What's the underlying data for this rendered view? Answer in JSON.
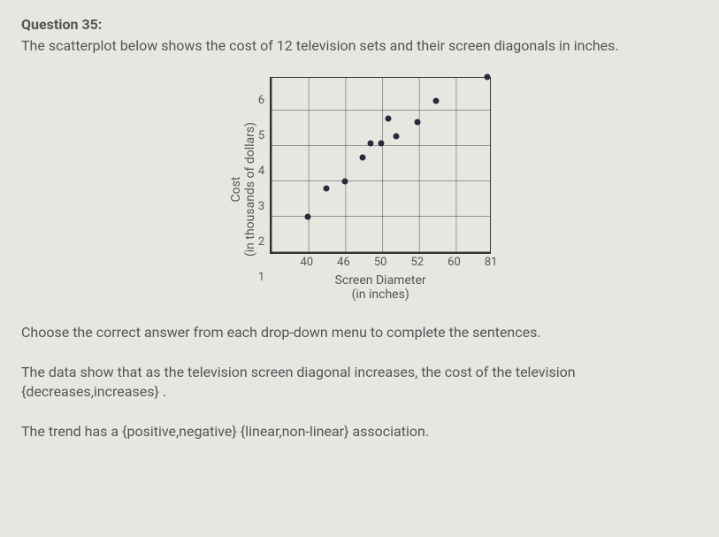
{
  "header": {
    "question_label": "Question 35:",
    "question_text": "The scatterplot below shows the cost of 12 television sets and their screen diagonals in inches."
  },
  "chart_data": {
    "type": "scatter",
    "title": "",
    "xlabel_line1": "Screen Diameter",
    "xlabel_line2": "(in inches)",
    "ylabel_line1": "Cost",
    "ylabel_line2": "(in thousands of dollars)",
    "x_ticks": [
      40,
      46,
      50,
      52,
      60,
      81
    ],
    "y_ticks": [
      1,
      2,
      3,
      4,
      5,
      6
    ],
    "x_cols": 6,
    "y_rows": 5,
    "points": [
      {
        "xi": 1.0,
        "yi": 1.0
      },
      {
        "xi": 1.5,
        "yi": 1.8
      },
      {
        "xi": 2.0,
        "yi": 2.0
      },
      {
        "xi": 2.5,
        "yi": 2.7
      },
      {
        "xi": 2.7,
        "yi": 3.1
      },
      {
        "xi": 3.0,
        "yi": 3.1
      },
      {
        "xi": 3.2,
        "yi": 3.8
      },
      {
        "xi": 3.4,
        "yi": 3.3
      },
      {
        "xi": 4.0,
        "yi": 3.7
      },
      {
        "xi": 4.5,
        "yi": 4.3
      },
      {
        "xi": 5.9,
        "yi": 5.0
      }
    ]
  },
  "body": {
    "instruction": "Choose the correct answer from each drop-down menu to complete the sentences.",
    "sentence1_a": "The data show that as the television screen diagonal increases, the cost of the television ",
    "sentence1_b": "{decreases,increases}",
    "sentence1_c": " .",
    "sentence2_a": "The trend has a ",
    "sentence2_b": "{positive,negative}",
    "sentence2_c": " ",
    "sentence2_d": "{linear,non-linear}",
    "sentence2_e": " association."
  }
}
